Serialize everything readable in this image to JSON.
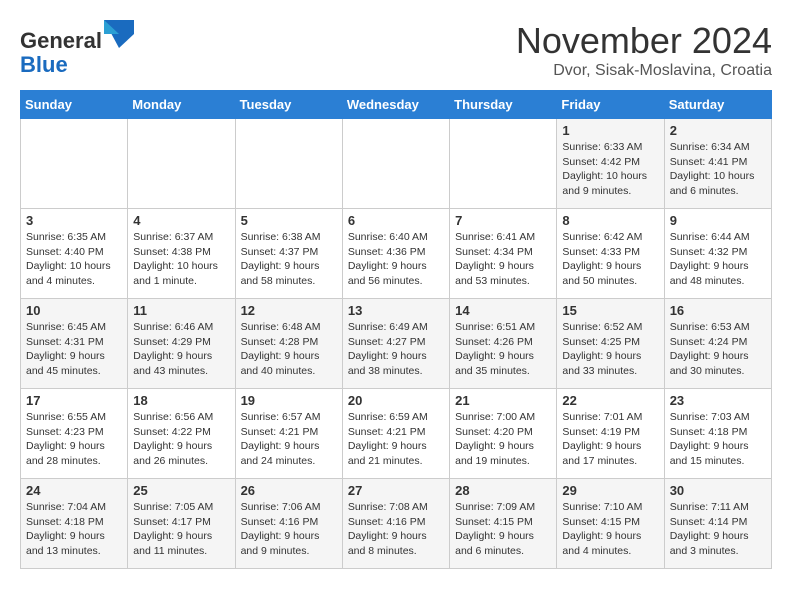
{
  "header": {
    "logo_general": "General",
    "logo_blue": "Blue",
    "month_title": "November 2024",
    "subtitle": "Dvor, Sisak-Moslavina, Croatia"
  },
  "weekdays": [
    "Sunday",
    "Monday",
    "Tuesday",
    "Wednesday",
    "Thursday",
    "Friday",
    "Saturday"
  ],
  "weeks": [
    [
      {
        "day": "",
        "info": ""
      },
      {
        "day": "",
        "info": ""
      },
      {
        "day": "",
        "info": ""
      },
      {
        "day": "",
        "info": ""
      },
      {
        "day": "",
        "info": ""
      },
      {
        "day": "1",
        "info": "Sunrise: 6:33 AM\nSunset: 4:42 PM\nDaylight: 10 hours and 9 minutes."
      },
      {
        "day": "2",
        "info": "Sunrise: 6:34 AM\nSunset: 4:41 PM\nDaylight: 10 hours and 6 minutes."
      }
    ],
    [
      {
        "day": "3",
        "info": "Sunrise: 6:35 AM\nSunset: 4:40 PM\nDaylight: 10 hours and 4 minutes."
      },
      {
        "day": "4",
        "info": "Sunrise: 6:37 AM\nSunset: 4:38 PM\nDaylight: 10 hours and 1 minute."
      },
      {
        "day": "5",
        "info": "Sunrise: 6:38 AM\nSunset: 4:37 PM\nDaylight: 9 hours and 58 minutes."
      },
      {
        "day": "6",
        "info": "Sunrise: 6:40 AM\nSunset: 4:36 PM\nDaylight: 9 hours and 56 minutes."
      },
      {
        "day": "7",
        "info": "Sunrise: 6:41 AM\nSunset: 4:34 PM\nDaylight: 9 hours and 53 minutes."
      },
      {
        "day": "8",
        "info": "Sunrise: 6:42 AM\nSunset: 4:33 PM\nDaylight: 9 hours and 50 minutes."
      },
      {
        "day": "9",
        "info": "Sunrise: 6:44 AM\nSunset: 4:32 PM\nDaylight: 9 hours and 48 minutes."
      }
    ],
    [
      {
        "day": "10",
        "info": "Sunrise: 6:45 AM\nSunset: 4:31 PM\nDaylight: 9 hours and 45 minutes."
      },
      {
        "day": "11",
        "info": "Sunrise: 6:46 AM\nSunset: 4:29 PM\nDaylight: 9 hours and 43 minutes."
      },
      {
        "day": "12",
        "info": "Sunrise: 6:48 AM\nSunset: 4:28 PM\nDaylight: 9 hours and 40 minutes."
      },
      {
        "day": "13",
        "info": "Sunrise: 6:49 AM\nSunset: 4:27 PM\nDaylight: 9 hours and 38 minutes."
      },
      {
        "day": "14",
        "info": "Sunrise: 6:51 AM\nSunset: 4:26 PM\nDaylight: 9 hours and 35 minutes."
      },
      {
        "day": "15",
        "info": "Sunrise: 6:52 AM\nSunset: 4:25 PM\nDaylight: 9 hours and 33 minutes."
      },
      {
        "day": "16",
        "info": "Sunrise: 6:53 AM\nSunset: 4:24 PM\nDaylight: 9 hours and 30 minutes."
      }
    ],
    [
      {
        "day": "17",
        "info": "Sunrise: 6:55 AM\nSunset: 4:23 PM\nDaylight: 9 hours and 28 minutes."
      },
      {
        "day": "18",
        "info": "Sunrise: 6:56 AM\nSunset: 4:22 PM\nDaylight: 9 hours and 26 minutes."
      },
      {
        "day": "19",
        "info": "Sunrise: 6:57 AM\nSunset: 4:21 PM\nDaylight: 9 hours and 24 minutes."
      },
      {
        "day": "20",
        "info": "Sunrise: 6:59 AM\nSunset: 4:21 PM\nDaylight: 9 hours and 21 minutes."
      },
      {
        "day": "21",
        "info": "Sunrise: 7:00 AM\nSunset: 4:20 PM\nDaylight: 9 hours and 19 minutes."
      },
      {
        "day": "22",
        "info": "Sunrise: 7:01 AM\nSunset: 4:19 PM\nDaylight: 9 hours and 17 minutes."
      },
      {
        "day": "23",
        "info": "Sunrise: 7:03 AM\nSunset: 4:18 PM\nDaylight: 9 hours and 15 minutes."
      }
    ],
    [
      {
        "day": "24",
        "info": "Sunrise: 7:04 AM\nSunset: 4:18 PM\nDaylight: 9 hours and 13 minutes."
      },
      {
        "day": "25",
        "info": "Sunrise: 7:05 AM\nSunset: 4:17 PM\nDaylight: 9 hours and 11 minutes."
      },
      {
        "day": "26",
        "info": "Sunrise: 7:06 AM\nSunset: 4:16 PM\nDaylight: 9 hours and 9 minutes."
      },
      {
        "day": "27",
        "info": "Sunrise: 7:08 AM\nSunset: 4:16 PM\nDaylight: 9 hours and 8 minutes."
      },
      {
        "day": "28",
        "info": "Sunrise: 7:09 AM\nSunset: 4:15 PM\nDaylight: 9 hours and 6 minutes."
      },
      {
        "day": "29",
        "info": "Sunrise: 7:10 AM\nSunset: 4:15 PM\nDaylight: 9 hours and 4 minutes."
      },
      {
        "day": "30",
        "info": "Sunrise: 7:11 AM\nSunset: 4:14 PM\nDaylight: 9 hours and 3 minutes."
      }
    ]
  ]
}
